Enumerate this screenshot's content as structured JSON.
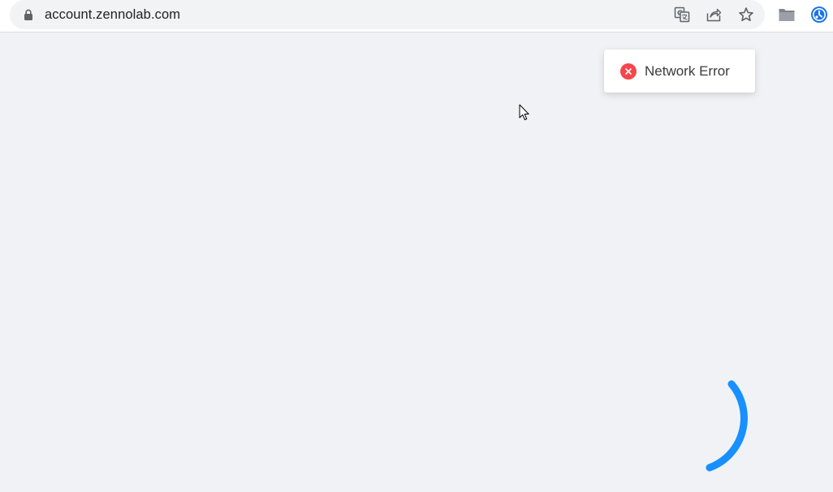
{
  "browser": {
    "url": "account.zennolab.com",
    "icons": {
      "lock": "lock-icon",
      "translate": "translate-icon",
      "share": "share-icon",
      "bookmark": "star-icon",
      "folder": "folder-icon",
      "extension": "extension-icon"
    },
    "extension_color": "#1a73e8"
  },
  "toast": {
    "message": "Network Error",
    "type": "error",
    "icon": "close-circle-icon",
    "icon_color": "#f5464e"
  },
  "loader": {
    "icon": "loading-spinner-icon",
    "color": "#1890ff"
  },
  "cursor": {
    "icon": "mouse-pointer-icon"
  }
}
